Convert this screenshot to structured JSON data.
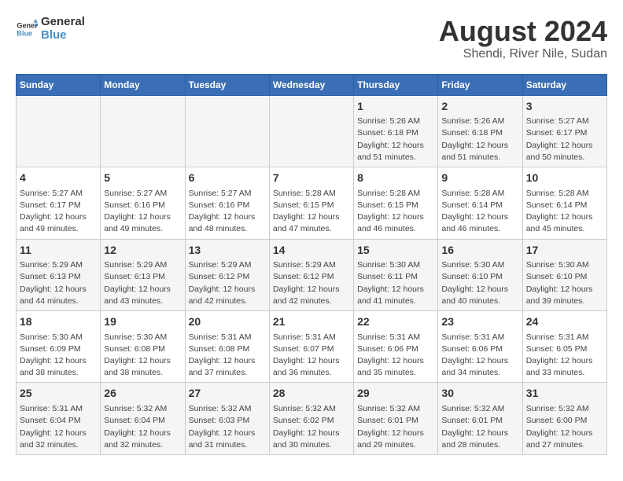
{
  "logo": {
    "line1": "General",
    "line2": "Blue"
  },
  "title": "August 2024",
  "subtitle": "Shendi, River Nile, Sudan",
  "headers": [
    "Sunday",
    "Monday",
    "Tuesday",
    "Wednesday",
    "Thursday",
    "Friday",
    "Saturday"
  ],
  "weeks": [
    [
      {
        "day": "",
        "info": ""
      },
      {
        "day": "",
        "info": ""
      },
      {
        "day": "",
        "info": ""
      },
      {
        "day": "",
        "info": ""
      },
      {
        "day": "1",
        "info": "Sunrise: 5:26 AM\nSunset: 6:18 PM\nDaylight: 12 hours\nand 51 minutes."
      },
      {
        "day": "2",
        "info": "Sunrise: 5:26 AM\nSunset: 6:18 PM\nDaylight: 12 hours\nand 51 minutes."
      },
      {
        "day": "3",
        "info": "Sunrise: 5:27 AM\nSunset: 6:17 PM\nDaylight: 12 hours\nand 50 minutes."
      }
    ],
    [
      {
        "day": "4",
        "info": "Sunrise: 5:27 AM\nSunset: 6:17 PM\nDaylight: 12 hours\nand 49 minutes."
      },
      {
        "day": "5",
        "info": "Sunrise: 5:27 AM\nSunset: 6:16 PM\nDaylight: 12 hours\nand 49 minutes."
      },
      {
        "day": "6",
        "info": "Sunrise: 5:27 AM\nSunset: 6:16 PM\nDaylight: 12 hours\nand 48 minutes."
      },
      {
        "day": "7",
        "info": "Sunrise: 5:28 AM\nSunset: 6:15 PM\nDaylight: 12 hours\nand 47 minutes."
      },
      {
        "day": "8",
        "info": "Sunrise: 5:28 AM\nSunset: 6:15 PM\nDaylight: 12 hours\nand 46 minutes."
      },
      {
        "day": "9",
        "info": "Sunrise: 5:28 AM\nSunset: 6:14 PM\nDaylight: 12 hours\nand 46 minutes."
      },
      {
        "day": "10",
        "info": "Sunrise: 5:28 AM\nSunset: 6:14 PM\nDaylight: 12 hours\nand 45 minutes."
      }
    ],
    [
      {
        "day": "11",
        "info": "Sunrise: 5:29 AM\nSunset: 6:13 PM\nDaylight: 12 hours\nand 44 minutes."
      },
      {
        "day": "12",
        "info": "Sunrise: 5:29 AM\nSunset: 6:13 PM\nDaylight: 12 hours\nand 43 minutes."
      },
      {
        "day": "13",
        "info": "Sunrise: 5:29 AM\nSunset: 6:12 PM\nDaylight: 12 hours\nand 42 minutes."
      },
      {
        "day": "14",
        "info": "Sunrise: 5:29 AM\nSunset: 6:12 PM\nDaylight: 12 hours\nand 42 minutes."
      },
      {
        "day": "15",
        "info": "Sunrise: 5:30 AM\nSunset: 6:11 PM\nDaylight: 12 hours\nand 41 minutes."
      },
      {
        "day": "16",
        "info": "Sunrise: 5:30 AM\nSunset: 6:10 PM\nDaylight: 12 hours\nand 40 minutes."
      },
      {
        "day": "17",
        "info": "Sunrise: 5:30 AM\nSunset: 6:10 PM\nDaylight: 12 hours\nand 39 minutes."
      }
    ],
    [
      {
        "day": "18",
        "info": "Sunrise: 5:30 AM\nSunset: 6:09 PM\nDaylight: 12 hours\nand 38 minutes."
      },
      {
        "day": "19",
        "info": "Sunrise: 5:30 AM\nSunset: 6:08 PM\nDaylight: 12 hours\nand 38 minutes."
      },
      {
        "day": "20",
        "info": "Sunrise: 5:31 AM\nSunset: 6:08 PM\nDaylight: 12 hours\nand 37 minutes."
      },
      {
        "day": "21",
        "info": "Sunrise: 5:31 AM\nSunset: 6:07 PM\nDaylight: 12 hours\nand 36 minutes."
      },
      {
        "day": "22",
        "info": "Sunrise: 5:31 AM\nSunset: 6:06 PM\nDaylight: 12 hours\nand 35 minutes."
      },
      {
        "day": "23",
        "info": "Sunrise: 5:31 AM\nSunset: 6:06 PM\nDaylight: 12 hours\nand 34 minutes."
      },
      {
        "day": "24",
        "info": "Sunrise: 5:31 AM\nSunset: 6:05 PM\nDaylight: 12 hours\nand 33 minutes."
      }
    ],
    [
      {
        "day": "25",
        "info": "Sunrise: 5:31 AM\nSunset: 6:04 PM\nDaylight: 12 hours\nand 32 minutes."
      },
      {
        "day": "26",
        "info": "Sunrise: 5:32 AM\nSunset: 6:04 PM\nDaylight: 12 hours\nand 32 minutes."
      },
      {
        "day": "27",
        "info": "Sunrise: 5:32 AM\nSunset: 6:03 PM\nDaylight: 12 hours\nand 31 minutes."
      },
      {
        "day": "28",
        "info": "Sunrise: 5:32 AM\nSunset: 6:02 PM\nDaylight: 12 hours\nand 30 minutes."
      },
      {
        "day": "29",
        "info": "Sunrise: 5:32 AM\nSunset: 6:01 PM\nDaylight: 12 hours\nand 29 minutes."
      },
      {
        "day": "30",
        "info": "Sunrise: 5:32 AM\nSunset: 6:01 PM\nDaylight: 12 hours\nand 28 minutes."
      },
      {
        "day": "31",
        "info": "Sunrise: 5:32 AM\nSunset: 6:00 PM\nDaylight: 12 hours\nand 27 minutes."
      }
    ]
  ]
}
